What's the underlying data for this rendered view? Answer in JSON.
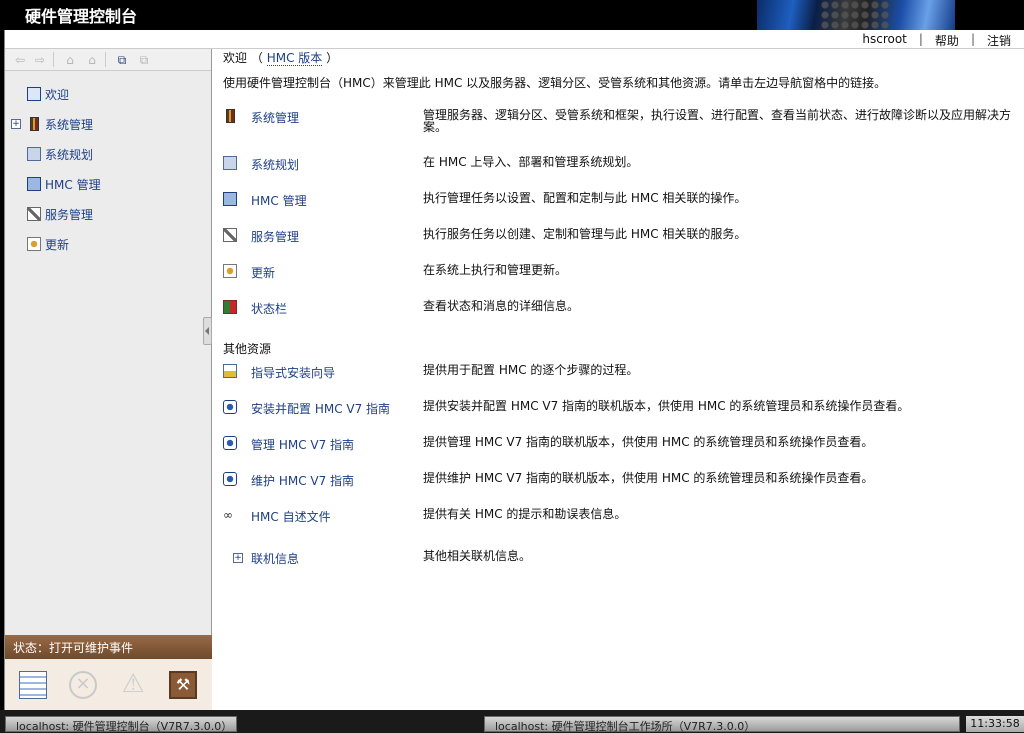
{
  "app": {
    "title": "硬件管理控制台"
  },
  "topnav": {
    "user": "hscroot",
    "help": "帮助",
    "logout": "注销",
    "sep": "|"
  },
  "nav": {
    "items": [
      {
        "label": "欢迎",
        "icon": "welcome-icon",
        "expandable": false
      },
      {
        "label": "系统管理",
        "icon": "systems-management-icon",
        "expandable": true
      },
      {
        "label": "系统规划",
        "icon": "system-plans-icon",
        "expandable": false
      },
      {
        "label": "HMC 管理",
        "icon": "hmc-management-icon",
        "expandable": false
      },
      {
        "label": "服务管理",
        "icon": "service-management-icon",
        "expandable": false
      },
      {
        "label": "更新",
        "icon": "updates-icon",
        "expandable": false
      }
    ],
    "expander": "+"
  },
  "status": {
    "label": "状态：打开可维护事件"
  },
  "content": {
    "welcome": "欢迎",
    "paren_open": "（",
    "version_link": "HMC 版本",
    "paren_close": "）",
    "intro": "使用硬件管理控制台（HMC）来管理此 HMC 以及服务器、逻辑分区、受管系统和其他资源。请单击左边导航窗格中的链接。",
    "rows": [
      {
        "label": "系统管理",
        "desc": "管理服务器、逻辑分区、受管系统和框架，执行设置、进行配置、查看当前状态、进行故障诊断以及应用解决方案。"
      },
      {
        "label": "系统规划",
        "desc": "在 HMC 上导入、部署和管理系统规划。"
      },
      {
        "label": "HMC 管理",
        "desc": "执行管理任务以设置、配置和定制与此 HMC 相关联的操作。"
      },
      {
        "label": "服务管理",
        "desc": "执行服务任务以创建、定制和管理与此 HMC 相关联的服务。"
      },
      {
        "label": "更新",
        "desc": "在系统上执行和管理更新。"
      },
      {
        "label": "状态栏",
        "desc": "查看状态和消息的详细信息。"
      }
    ],
    "other_header": "其他资源",
    "other_rows": [
      {
        "label": "指导式安装向导",
        "desc": "提供用于配置 HMC 的逐个步骤的过程。"
      },
      {
        "label": "安装并配置 HMC V7 指南",
        "desc": "提供安装并配置 HMC V7 指南的联机版本，供使用 HMC 的系统管理员和系统操作员查看。"
      },
      {
        "label": "管理 HMC V7 指南",
        "desc": "提供管理 HMC V7 指南的联机版本，供使用 HMC 的系统管理员和系统操作员查看。"
      },
      {
        "label": "维护 HMC V7 指南",
        "desc": "提供维护 HMC V7 指南的联机版本，供使用 HMC 的系统管理员和系统操作员查看。"
      },
      {
        "label": "HMC 自述文件",
        "desc": "提供有关 HMC 的提示和勘误表信息。"
      },
      {
        "label": "联机信息",
        "desc": "其他相关联机信息。"
      }
    ]
  },
  "taskbar": {
    "task1": "localhost: 硬件管理控制台（V7R7.3.0.0）",
    "task2": "localhost: 硬件管理控制台工作场所（V7R7.3.0.0）",
    "clock": "11:33:58"
  }
}
